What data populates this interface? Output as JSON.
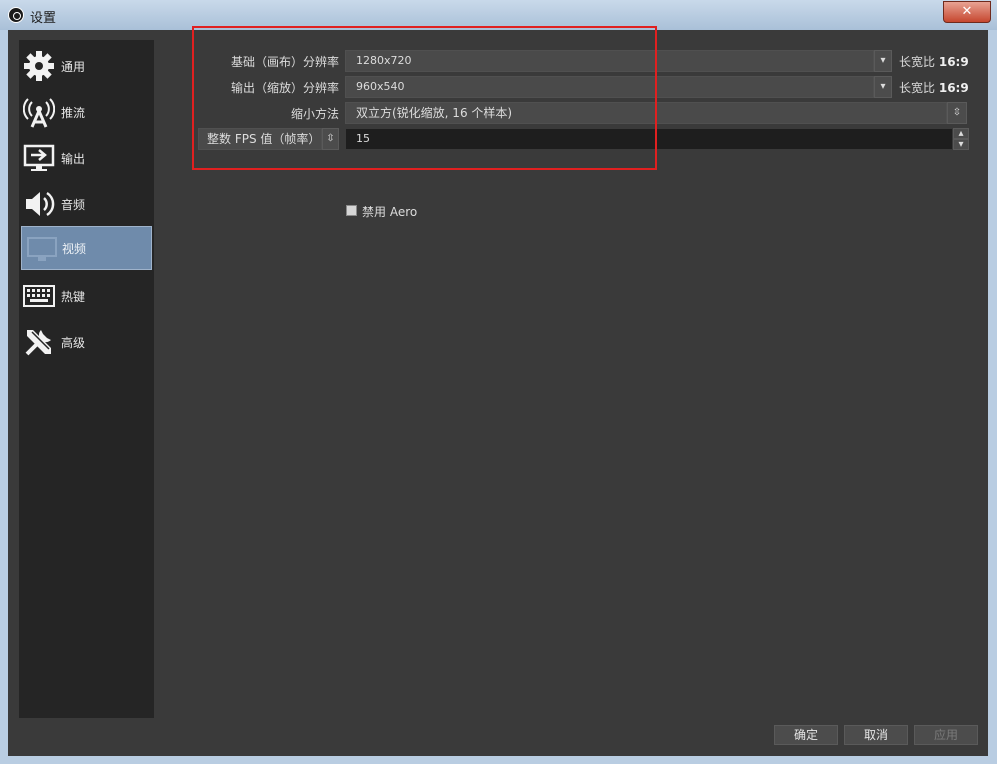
{
  "window": {
    "title": "设置",
    "close_glyph": "✕"
  },
  "sidebar": {
    "items": [
      {
        "label": "通用",
        "icon": "gear-icon"
      },
      {
        "label": "推流",
        "icon": "antenna-icon"
      },
      {
        "label": "输出",
        "icon": "output-monitor-icon"
      },
      {
        "label": "音频",
        "icon": "speaker-icon"
      },
      {
        "label": "视频",
        "icon": "video-monitor-icon",
        "active": true
      },
      {
        "label": "热键",
        "icon": "keyboard-icon"
      },
      {
        "label": "高级",
        "icon": "tools-icon"
      }
    ]
  },
  "video": {
    "base_resolution": {
      "label": "基础（画布）分辨率",
      "value": "1280x720",
      "ratio_label": "长宽比",
      "ratio_value": "16:9"
    },
    "output_resolution": {
      "label": "输出（缩放）分辨率",
      "value": "960x540",
      "ratio_label": "长宽比",
      "ratio_value": "16:9"
    },
    "downscale_filter": {
      "label": "缩小方法",
      "value": "双立方(锐化缩放, 16 个样本)"
    },
    "fps_type": {
      "label": "整数 FPS 值（帧率）",
      "value": "15"
    },
    "disable_aero": {
      "label": "禁用 Aero",
      "checked": false
    }
  },
  "buttons": {
    "ok": "确定",
    "cancel": "取消",
    "apply": "应用"
  },
  "colors": {
    "highlight": "#e02020",
    "active_nav": "#6f8bab",
    "panel": "#3a3a3a",
    "sidebar": "#252525"
  }
}
